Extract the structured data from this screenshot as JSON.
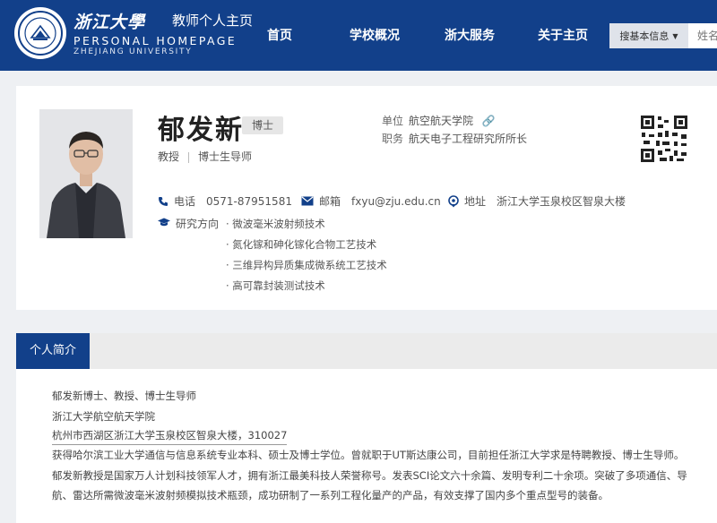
{
  "header": {
    "logo_cn": "浙江大學",
    "logo_sub": "教师个人主页",
    "logo_en1": "PERSONAL HOMEPAGE",
    "logo_en2": "ZHEJIANG UNIVERSITY",
    "nav": [
      "首页",
      "学校概况",
      "浙大服务",
      "关于主页"
    ],
    "search_select": "搜基本信息",
    "search_placeholder": "姓名"
  },
  "profile": {
    "name": "郁发新",
    "degree": "博士",
    "title": "教授",
    "supervisor": "博士生导师",
    "unit_label": "单位",
    "unit": "航空航天学院",
    "position_label": "职务",
    "position": "航天电子工程研究所所长",
    "phone_label": "电话",
    "phone": "0571-87951581",
    "email_label": "邮箱",
    "email": "fxyu@zju.edu.cn",
    "address_label": "地址",
    "address": "浙江大学玉泉校区智泉大楼",
    "research_label": "研究方向",
    "research": [
      "· 微波毫米波射频技术",
      "· 氮化镓和砷化镓化合物工艺技术",
      "· 三维异构异质集成微系统工艺技术",
      "· 高可靠封装测试技术"
    ]
  },
  "intro": {
    "tab": "个人简介",
    "lines": [
      "郁发新博士、教授、博士生导师",
      "浙江大学航空航天学院",
      "杭州市西湖区浙江大学玉泉校区智泉大楼，310027",
      "获得哈尔滨工业大学通信与信息系统专业本科、硕士及博士学位。曾就职于UT斯达康公司，目前担任浙江大学求是特聘教授、博士生导师。",
      "郁发新教授是国家万人计划科技领军人才，拥有浙江最美科技人荣誉称号。发表SCI论文六十余篇、发明专利二十余项。突破了多项通信、导",
      "航、雷达所需微波毫米波射频模拟技术瓶颈，成功研制了一系列工程化量产的产品，有效支撑了国内多个重点型号的装备。"
    ]
  }
}
